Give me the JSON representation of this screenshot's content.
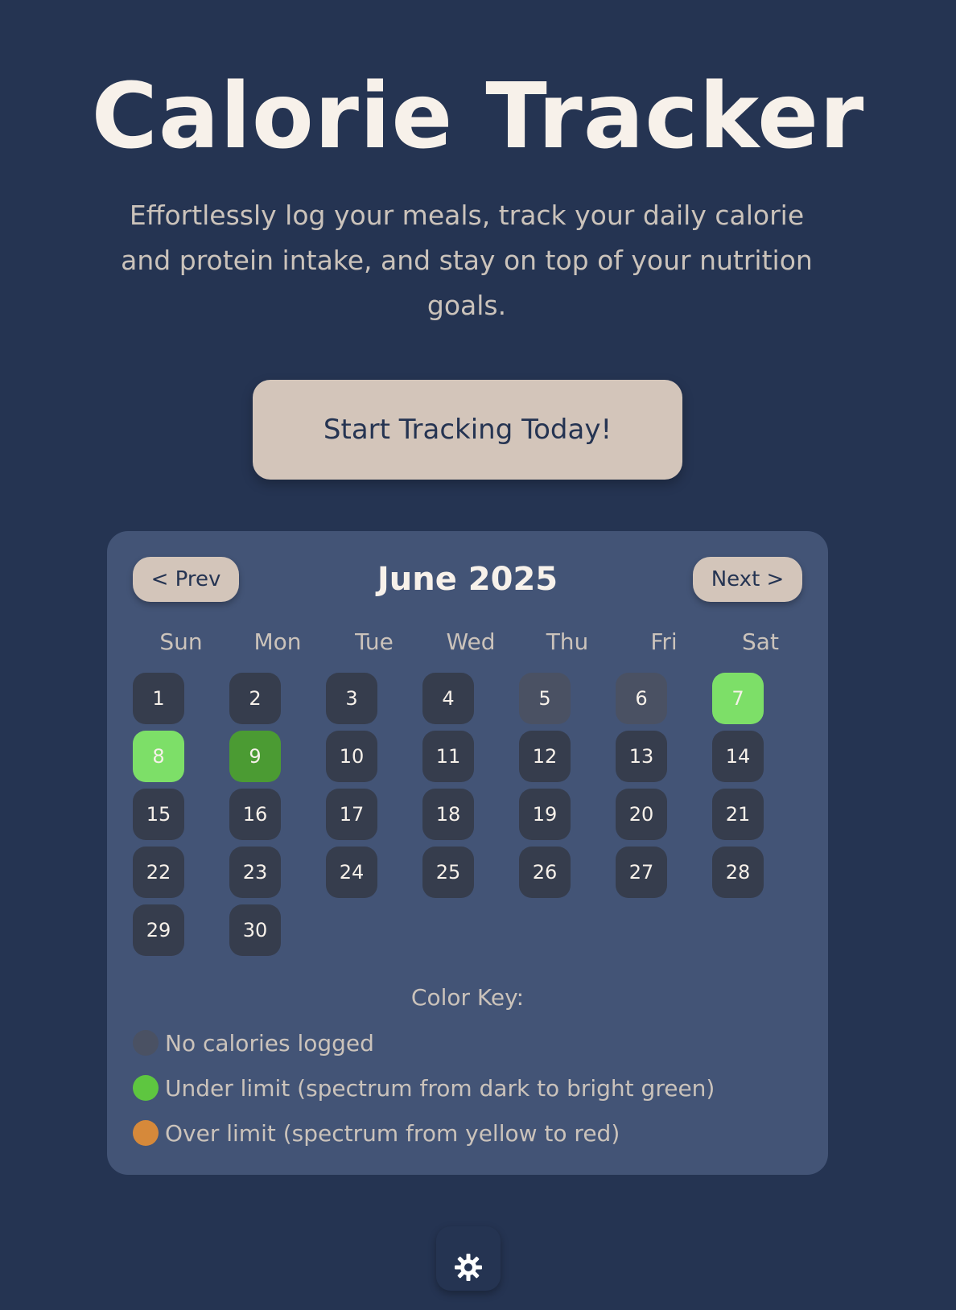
{
  "hero": {
    "title": "Calorie Tracker",
    "subtitle": "Effortlessly log your meals, track your daily calorie and protein intake, and stay on top of your nutrition goals.",
    "cta_label": "Start Tracking Today!"
  },
  "calendar": {
    "prev_label": "< Prev",
    "next_label": "Next >",
    "month_label": "June 2025",
    "weekdays": [
      "Sun",
      "Mon",
      "Tue",
      "Wed",
      "Thu",
      "Fri",
      "Sat"
    ],
    "first_weekday_index": 0,
    "days": [
      {
        "label": "1",
        "status": "default"
      },
      {
        "label": "2",
        "status": "default"
      },
      {
        "label": "3",
        "status": "default"
      },
      {
        "label": "4",
        "status": "default"
      },
      {
        "label": "5",
        "status": "none"
      },
      {
        "label": "6",
        "status": "none"
      },
      {
        "label": "7",
        "status": "under-bright"
      },
      {
        "label": "8",
        "status": "under-bright"
      },
      {
        "label": "9",
        "status": "under-dark"
      },
      {
        "label": "10",
        "status": "default"
      },
      {
        "label": "11",
        "status": "default"
      },
      {
        "label": "12",
        "status": "default"
      },
      {
        "label": "13",
        "status": "default"
      },
      {
        "label": "14",
        "status": "default"
      },
      {
        "label": "15",
        "status": "default"
      },
      {
        "label": "16",
        "status": "default"
      },
      {
        "label": "17",
        "status": "default"
      },
      {
        "label": "18",
        "status": "default"
      },
      {
        "label": "19",
        "status": "default"
      },
      {
        "label": "20",
        "status": "default"
      },
      {
        "label": "21",
        "status": "default"
      },
      {
        "label": "22",
        "status": "default"
      },
      {
        "label": "23",
        "status": "default"
      },
      {
        "label": "24",
        "status": "default"
      },
      {
        "label": "25",
        "status": "default"
      },
      {
        "label": "26",
        "status": "default"
      },
      {
        "label": "27",
        "status": "default"
      },
      {
        "label": "28",
        "status": "default"
      },
      {
        "label": "29",
        "status": "default"
      },
      {
        "label": "30",
        "status": "default"
      }
    ]
  },
  "status_colors": {
    "default": "#363d4d",
    "none": "#4a5163",
    "under-bright": "#7ddf68",
    "under-dark": "#4b9b33"
  },
  "color_key": {
    "title": "Color Key:",
    "items": [
      {
        "label": "No calories logged",
        "color": "#4a5163"
      },
      {
        "label": "Under limit (spectrum from dark to bright green)",
        "color": "#5ec640"
      },
      {
        "label": "Over limit (spectrum from yellow to red)",
        "color": "#d6893a"
      }
    ]
  },
  "theme_toggle": {
    "icon": "sun-icon"
  }
}
